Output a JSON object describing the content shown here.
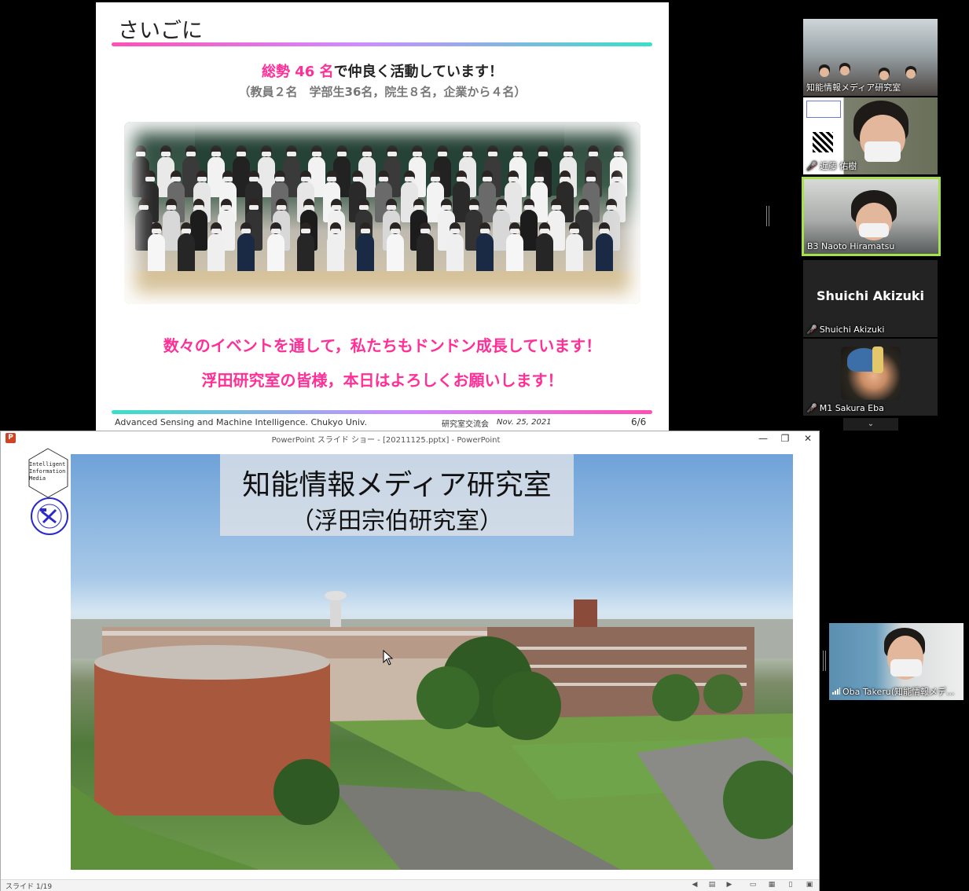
{
  "shared_slide": {
    "title": "さいごに",
    "headline_highlight": "総勢 46 名",
    "headline_rest": "で仲良く活動しています！",
    "subline": "（教員２名　学部生36名，院生８名，企業から４名）",
    "message_1": "数々のイベントを通して，私たちもドンドン成長しています！",
    "message_2": "浮田研究室の皆様，本日はよろしくお願いします！",
    "footer_left": "Advanced Sensing and Machine Intelligence. Chukyo Univ.",
    "footer_mid": "研究室交流会",
    "footer_date": "Nov. 25, 2021",
    "footer_page": "6/6"
  },
  "gallery": {
    "tiles": [
      {
        "name": "知能情報メディア研究室",
        "muted": false
      },
      {
        "name": "近藤 佑樹",
        "muted": true
      },
      {
        "name": "B3 Naoto Hiramatsu",
        "muted": false,
        "active_speaker": true
      },
      {
        "name": "Shuichi Akizuki",
        "display_name": "Shuichi Akizuki",
        "muted": true
      },
      {
        "name": "M1 Sakura Eba",
        "muted": true
      }
    ],
    "more_label": "⌄",
    "self_view": {
      "name": "Oba Takeru(知能情報メデ..."
    }
  },
  "ppt": {
    "window_title": "PowerPoint スライド ショー - [20211125.pptx] - PowerPoint",
    "app_icon": "P",
    "minimize_icon": "—",
    "restore_icon": "❐",
    "close_icon": "✕",
    "logo_text_lines": [
      "Intelligent",
      "Information",
      "Media"
    ],
    "slide_title_1": "知能情報メディア研究室",
    "slide_title_2": "（浮田宗伯研究室）",
    "slide_counter": "スライド 1/19",
    "status_icons": [
      "prev-icon",
      "notes-icon",
      "next-icon",
      "normal-view-icon",
      "slide-sorter-icon",
      "reading-view-icon",
      "slideshow-icon"
    ]
  },
  "colors": {
    "accent_pink": "#ff2f97",
    "active_speaker_border": "#a6e04a",
    "mic_muted": "#e23c3c"
  }
}
